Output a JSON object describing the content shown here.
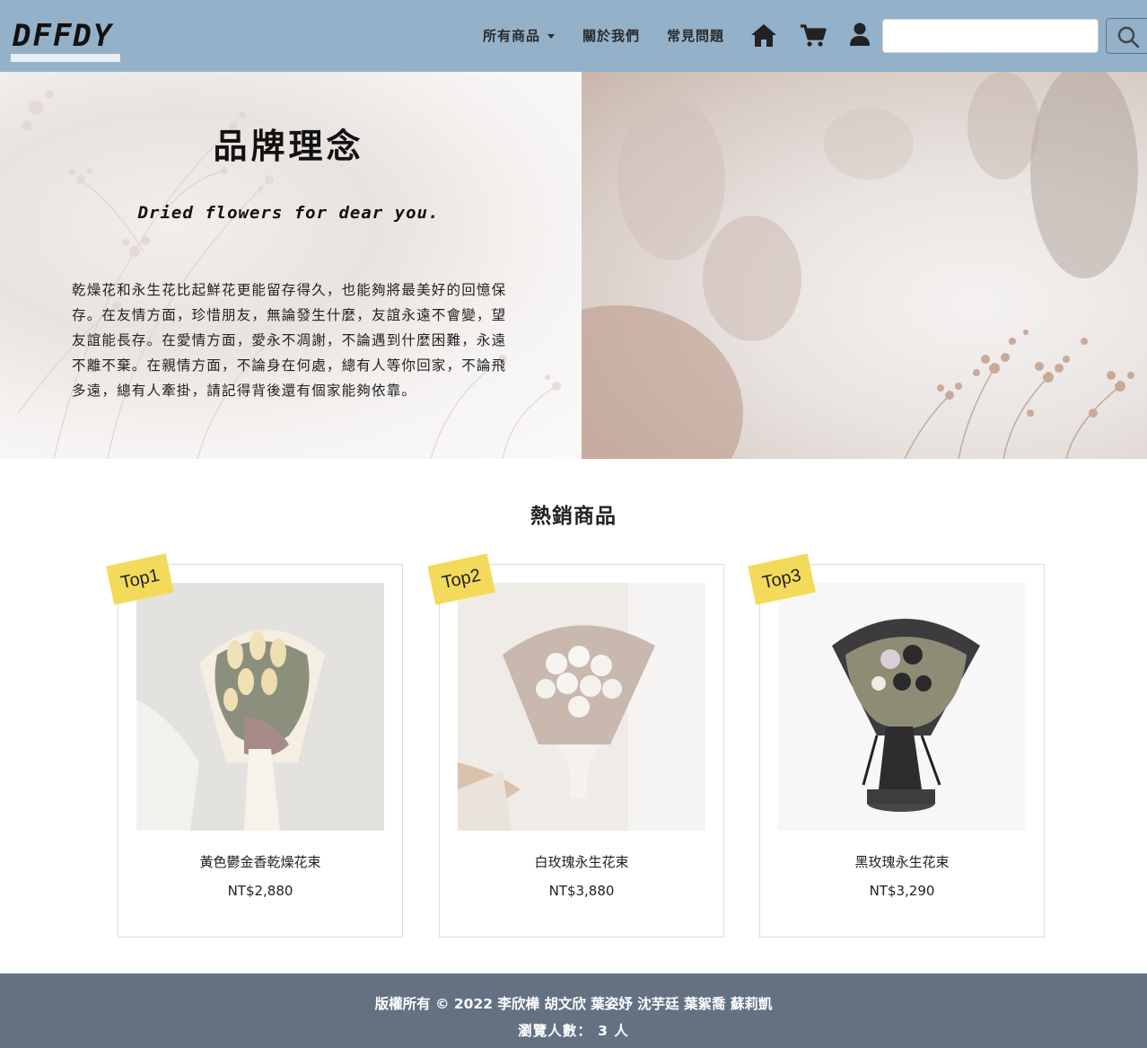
{
  "navbar": {
    "logo": "DFFDY",
    "links": [
      {
        "label": "所有商品",
        "dropdown": true
      },
      {
        "label": "關於我們"
      },
      {
        "label": "常見問題"
      }
    ],
    "icons": [
      "home-icon",
      "cart-icon",
      "user-icon",
      "search-icon"
    ],
    "search": {
      "value": "",
      "placeholder": ""
    },
    "bg_color": "#93b1c9"
  },
  "hero": {
    "title": "品牌理念",
    "subtitle": "Dried flowers for dear you.",
    "text": "乾燥花和永生花比起鮮花更能留存得久，也能夠將最美好的回憶保存。在友情方面，珍惜朋友，無論發生什麼，友誼永遠不會變，望友誼能長存。在愛情方面，愛永不凋謝，不論遇到什麼困難，永遠不離不棄。在親情方面，不論身在何處，總有人等你回家，不論飛多遠，總有人牽掛，請記得背後還有個家能夠依靠。"
  },
  "best_sellers": {
    "title": "熱銷商品",
    "products": [
      {
        "rank": "Top1",
        "name": "黃色鬱金香乾燥花束",
        "price": "NT$2,880"
      },
      {
        "rank": "Top2",
        "name": "白玫瑰永生花束",
        "price": "NT$3,880"
      },
      {
        "rank": "Top3",
        "name": "黑玫瑰永生花束",
        "price": "NT$3,290"
      }
    ],
    "tag_color": "#f4da5a"
  },
  "footer": {
    "copyright": "版權所有 © 2022 李欣樺 胡文欣 葉姿妤 沈芋廷 葉絮喬 蘇莉凱",
    "visits": "瀏覽人數： 3 人",
    "bg_color": "#637183"
  }
}
